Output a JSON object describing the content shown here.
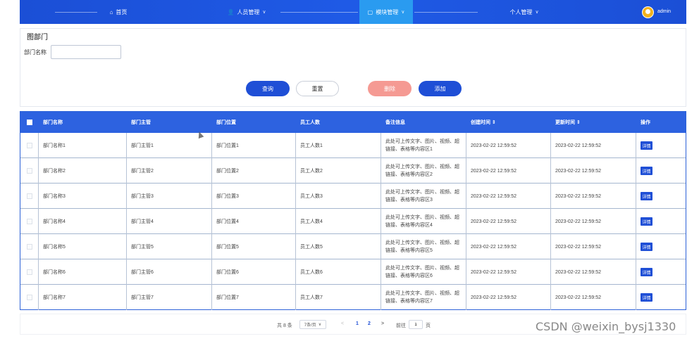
{
  "nav": {
    "items": [
      {
        "icon": "⌂",
        "label": "首页",
        "has_chevron": false,
        "active": false
      },
      {
        "icon": "👤",
        "label": "人员管理",
        "has_chevron": true,
        "active": false
      },
      {
        "icon": "▢",
        "label": "模块管理",
        "has_chevron": true,
        "active": true
      },
      {
        "icon": "",
        "label": "个人管理",
        "has_chevron": true,
        "active": false
      }
    ],
    "chevron": "∨",
    "user": "admin"
  },
  "search": {
    "tag": "图部门",
    "field_label": "部门名称",
    "field_value": "",
    "buttons": {
      "query": "查询",
      "reset": "重置",
      "delete": "删除",
      "add": "添加"
    }
  },
  "table": {
    "headers": {
      "name": "部门名称",
      "manager": "部门主管",
      "location": "部门位置",
      "count": "员工人数",
      "note": "备注信息",
      "created": "创建时间 ⇕",
      "updated": "更新时间 ⇕",
      "op": "操作"
    },
    "detail_label": "详情",
    "rows": [
      {
        "name": "部门名称1",
        "manager": "部门主管1",
        "location": "部门位置1",
        "count": "员工人数1",
        "note": "此处可上传文字、图片、视频、超链接、表格等内容区1",
        "created": "2023-02-22 12:59:52",
        "updated": "2023-02-22 12:59:52"
      },
      {
        "name": "部门名称2",
        "manager": "部门主管2",
        "location": "部门位置2",
        "count": "员工人数2",
        "note": "此处可上传文字、图片、视频、超链接、表格等内容区2",
        "created": "2023-02-22 12:59:52",
        "updated": "2023-02-22 12:59:52"
      },
      {
        "name": "部门名称3",
        "manager": "部门主管3",
        "location": "部门位置3",
        "count": "员工人数3",
        "note": "此处可上传文字、图片、视频、超链接、表格等内容区3",
        "created": "2023-02-22 12:59:52",
        "updated": "2023-02-22 12:59:52"
      },
      {
        "name": "部门名称4",
        "manager": "部门主管4",
        "location": "部门位置4",
        "count": "员工人数4",
        "note": "此处可上传文字、图片、视频、超链接、表格等内容区4",
        "created": "2023-02-22 12:59:52",
        "updated": "2023-02-22 12:59:52"
      },
      {
        "name": "部门名称5",
        "manager": "部门主管5",
        "location": "部门位置5",
        "count": "员工人数5",
        "note": "此处可上传文字、图片、视频、超链接、表格等内容区5",
        "created": "2023-02-22 12:59:52",
        "updated": "2023-02-22 12:59:52"
      },
      {
        "name": "部门名称6",
        "manager": "部门主管6",
        "location": "部门位置6",
        "count": "员工人数6",
        "note": "此处可上传文字、图片、视频、超链接、表格等内容区6",
        "created": "2023-02-22 12:59:52",
        "updated": "2023-02-22 12:59:52"
      },
      {
        "name": "部门名称7",
        "manager": "部门主管7",
        "location": "部门位置7",
        "count": "员工人数7",
        "note": "此处可上传文字、图片、视频、超链接、表格等内容区7",
        "created": "2023-02-22 12:59:52",
        "updated": "2023-02-22 12:59:52"
      }
    ]
  },
  "pagination": {
    "total": "共 8 条",
    "page_size": "7条/页",
    "dropdown_icon": "∨",
    "prev": "<",
    "pages": [
      "1",
      "2"
    ],
    "current_page": "1",
    "next": ">",
    "goto_label": "前往",
    "goto_value": "1",
    "page_unit": "页"
  },
  "watermark": "CSDN @weixin_bysj1330",
  "colors": {
    "primary": "#1f4fd6",
    "header_bg": "#2d62e0",
    "active_tab": "#2a9bf0",
    "delete": "#f59a93"
  }
}
